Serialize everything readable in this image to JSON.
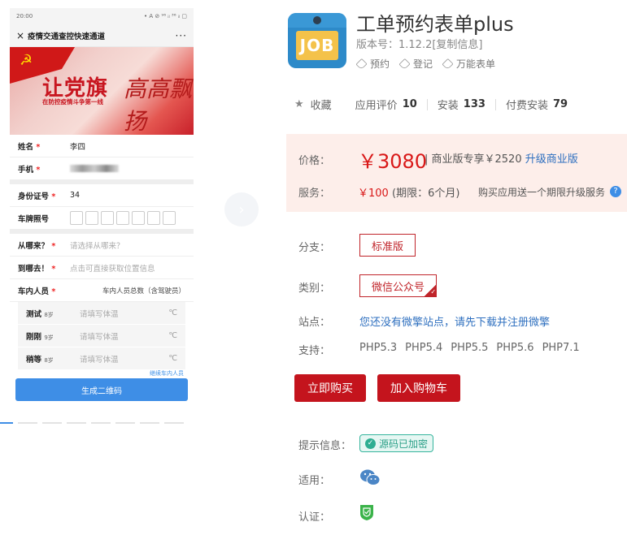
{
  "phone": {
    "status_time": "20:00",
    "status_right": "• A ⊘ ⁹⁶ ᵢₗ ³⁶ ᵢₗ ▢",
    "close_glyph": "×",
    "title": "疫情交通查控快速通道",
    "more_glyph": "···",
    "banner": {
      "emblem_glyph": "☭",
      "headline": "让党旗",
      "subline": "在防控疫情斗争第一线",
      "calligraphy": "高高飘扬"
    },
    "fields": [
      {
        "label": "姓名",
        "required": "*",
        "value": "李四"
      },
      {
        "label": "手机",
        "required": "*",
        "value": ""
      },
      {
        "label": "身份证号",
        "required": "*",
        "value": "34"
      },
      {
        "label": "车牌照号",
        "required": "",
        "value": ""
      },
      {
        "label": "从哪来？",
        "required": "*",
        "value": "请选择从哪来？"
      },
      {
        "label": "到哪去！",
        "required": "*",
        "value": "点击可直接获取位置信息"
      },
      {
        "label": "车内人员",
        "required": "*",
        "value": "车内人员总数（含驾驶员）"
      }
    ],
    "persons": [
      {
        "name": "测试",
        "age": "8岁",
        "placeholder": "请填写体温",
        "unit": "℃"
      },
      {
        "name": "刚刚",
        "age": "9岁",
        "placeholder": "请填写体温",
        "unit": "℃"
      },
      {
        "name": "稍等",
        "age": "8岁",
        "placeholder": "请填写体温",
        "unit": "℃"
      }
    ],
    "more_link": "继续车内人员",
    "qr_button": "生成二维码"
  },
  "carousel_next": "›",
  "app": {
    "icon_text": "JOB",
    "title": "工单预约表单plus",
    "version": "版本号：1.12.2[复制信息]",
    "tags": [
      "预约",
      "登记",
      "万能表单"
    ],
    "stats": {
      "favorite": "收藏",
      "rating_label": "应用评价",
      "rating_value": "10",
      "install_label": "安装",
      "install_value": "133",
      "paid_label": "付费安装",
      "paid_value": "79"
    }
  },
  "pricing": {
    "price_label": "价格：",
    "price_value": "￥3080",
    "pro_text": "| 商业版专享￥2520",
    "upgrade_link": "升级商业版",
    "service_label": "服务：",
    "service_value": "￥100",
    "service_term": "(期限：6个月)",
    "service_note": "购买应用送一个期限升级服务",
    "help_glyph": "?"
  },
  "options": {
    "branch_label": "分支：",
    "branch_value": "标准版",
    "category_label": "类别：",
    "category_value": "微信公众号",
    "site_label": "站点：",
    "site_text": "您还没有微擎站点，请先下载并注册微擎",
    "support_label": "支持：",
    "php_versions": [
      "PHP5.3",
      "PHP5.4",
      "PHP5.5",
      "PHP5.6",
      "PHP7.1"
    ]
  },
  "actions": {
    "buy_now": "立即购买",
    "add_cart": "加入购物车"
  },
  "info": {
    "tip_label": "提示信息：",
    "encrypted_badge": "源码已加密",
    "applies_label": "适用：",
    "cert_label": "认证："
  },
  "colors": {
    "accent_red": "#c4141d",
    "link_blue": "#2e6fbf",
    "price_bg": "#fdeeea",
    "badge_green": "#2fae92"
  }
}
